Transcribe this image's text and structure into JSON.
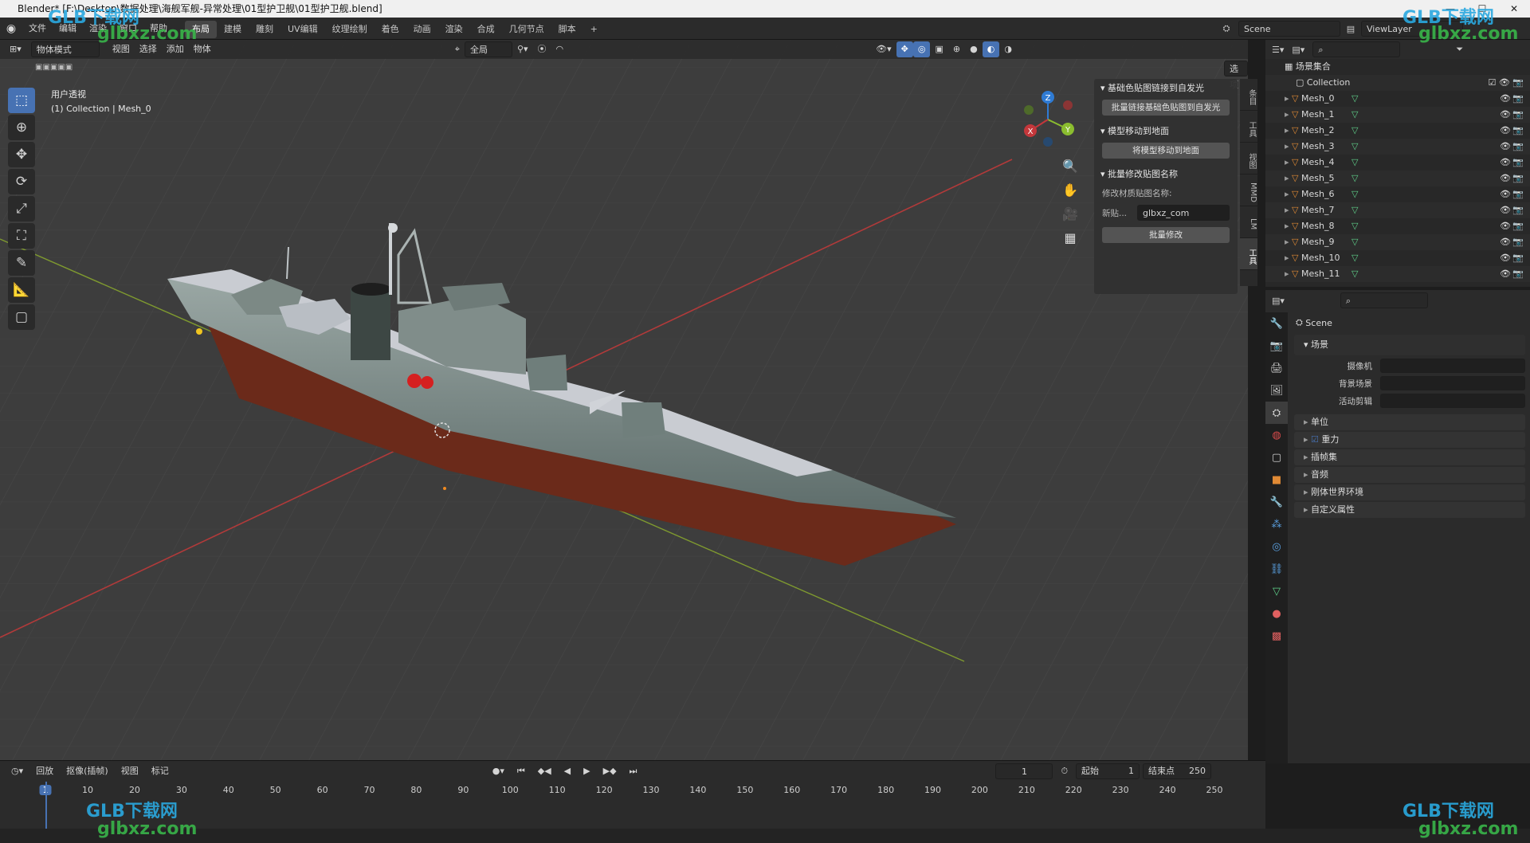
{
  "window": {
    "title": "Blender* [F:\\Desktop\\数据处理\\海舰军舰-异常处理\\01型护卫舰\\01型护卫舰.blend]"
  },
  "menu": [
    "文件",
    "编辑",
    "渲染",
    "窗口",
    "帮助"
  ],
  "workspaces": [
    "布局",
    "建模",
    "雕刻",
    "UV编辑",
    "纹理绘制",
    "着色",
    "动画",
    "渲染",
    "合成",
    "几何节点",
    "脚本"
  ],
  "active_workspace": "布局",
  "scene_field": "Scene",
  "viewlayer_field": "ViewLayer",
  "viewport": {
    "mode": "物体模式",
    "menus": [
      "视图",
      "选择",
      "添加",
      "物体"
    ],
    "transform_orient": "全局",
    "options_label": "选项",
    "overlay_title": "用户透视",
    "overlay_sub": "(1) Collection | Mesh_0",
    "gizmo": {
      "z": "Z",
      "y": "Y",
      "x": "X"
    }
  },
  "npanel": {
    "sections": [
      {
        "title": "基础色贴图链接到自发光",
        "button": "批量链接基础色贴图到自发光"
      },
      {
        "title": "模型移动到地面",
        "button": "将模型移动到地面"
      },
      {
        "title": "批量修改贴图名称",
        "field_label": "修改材质贴图名称:",
        "input_label": "新贴...",
        "input_value": "glbxz_com",
        "button": "批量修改"
      }
    ],
    "tabs": [
      "条目",
      "工具",
      "视图",
      "MMD",
      "LM",
      "工具"
    ]
  },
  "outliner": {
    "root": "场景集合",
    "collection": "Collection",
    "items": [
      "Mesh_0",
      "Mesh_1",
      "Mesh_2",
      "Mesh_3",
      "Mesh_4",
      "Mesh_5",
      "Mesh_6",
      "Mesh_7",
      "Mesh_8",
      "Mesh_9",
      "Mesh_10",
      "Mesh_11"
    ]
  },
  "properties": {
    "breadcrumb": "Scene",
    "section": "场景",
    "fields": [
      {
        "label": "摄像机",
        "value": ""
      },
      {
        "label": "背景场景",
        "value": ""
      },
      {
        "label": "活动剪辑",
        "value": ""
      }
    ],
    "collapsed": [
      "单位",
      "重力",
      "插帧集",
      "音频",
      "刚体世界环境",
      "自定义属性"
    ]
  },
  "timeline": {
    "menus": [
      "回放",
      "抠像(插帧)",
      "视图",
      "标记"
    ],
    "current_frame": "1",
    "start_label": "起始",
    "start": "1",
    "end_label": "结束点",
    "end": "250",
    "ticks": [
      "1",
      "10",
      "20",
      "30",
      "40",
      "50",
      "60",
      "70",
      "80",
      "90",
      "100",
      "110",
      "120",
      "130",
      "140",
      "150",
      "160",
      "170",
      "180",
      "190",
      "200",
      "210",
      "220",
      "230",
      "240",
      "250"
    ]
  },
  "watermark": {
    "brand": "GLB下载网",
    "url": "glbxz.com"
  },
  "colors": {
    "accent": "#4772b3",
    "x_axis": "#c4373b",
    "y_axis": "#8bbd2f",
    "z_axis": "#2f7bd4",
    "ship_hull": "#7e8f8c",
    "ship_deck": "#c9ccd2",
    "water_line": "#6b2a1a"
  }
}
